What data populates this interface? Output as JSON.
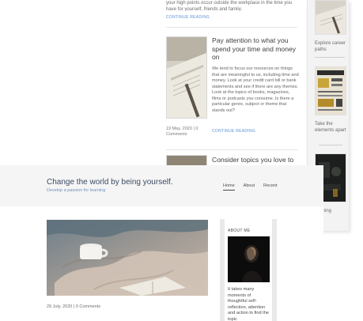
{
  "background_page": {
    "top_post": {
      "excerpt": "your high points occur outside the workplace in the time you have for yourself, friends and family.",
      "continue": "CONTINUE READING"
    },
    "middle_post": {
      "title": "Pay attention to what you spend your time and money on",
      "excerpt": "We tend to focus our resources on things that are meaningful to us, including time and money. Look at your credit card bill or bank statements and see if there are any themes. Look at the topics of books, magazines, films or podcasts you consume. Is there a particular genre, subject or theme that stands out?",
      "meta": "19 May, 2020 | 0 Comments",
      "continue": "CONTINUE READING"
    },
    "bottom_post": {
      "title": "Consider topics you love to"
    },
    "sidebar": {
      "items": [
        {
          "caption": "Explore career paths"
        },
        {
          "caption": "Take the elements apart"
        },
        {
          "caption": "g ything"
        }
      ]
    }
  },
  "foreground": {
    "site_title": "Change the world by being yourself.",
    "tagline": "Develop a passion for learning",
    "nav": [
      {
        "label": "Home",
        "active": true
      },
      {
        "label": "About",
        "active": false
      },
      {
        "label": "Recent",
        "active": false
      }
    ],
    "post_meta": "29 July, 2020 | 0 Comments",
    "about": {
      "title": "ABOUT ME",
      "text": "It takes many moments of thoughtful self-reflection, attention and action to find the topic"
    }
  },
  "colors": {
    "link": "#5b8fd6",
    "title": "#3c4a63",
    "tagline": "#6f8fbf",
    "header_bg": "#f5f5f5"
  }
}
